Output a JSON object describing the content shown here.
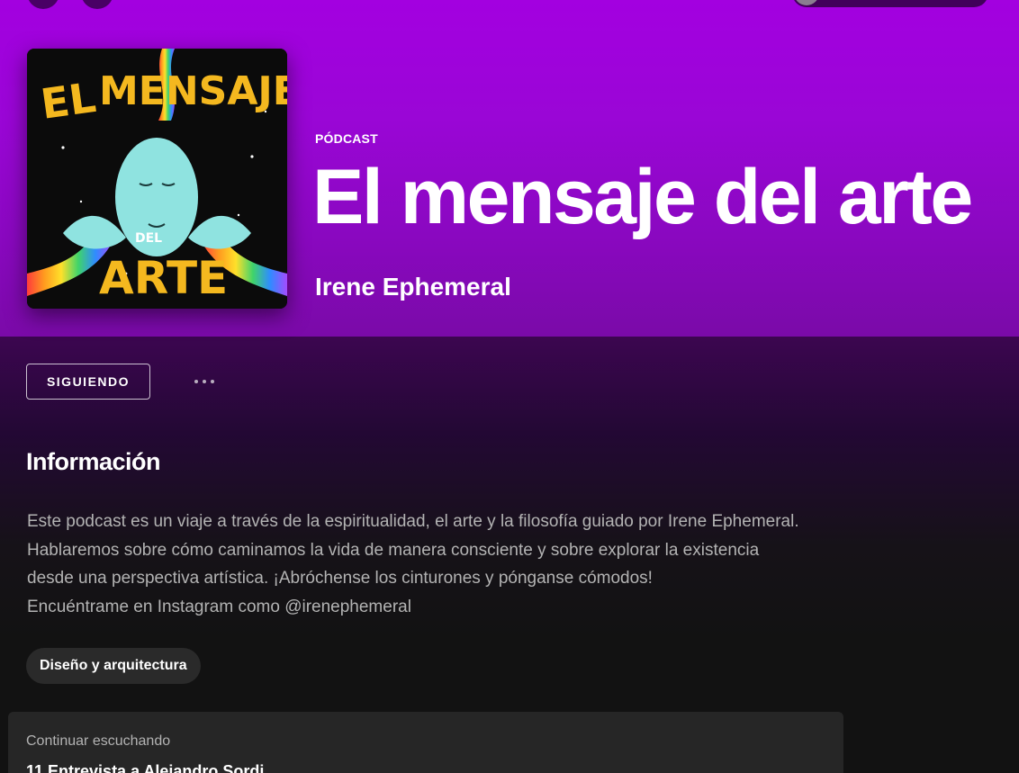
{
  "header": {
    "type_label": "PÓDCAST",
    "title": "El mensaje del arte",
    "author": "Irene Ephemeral"
  },
  "cover": {
    "icon": "podcast-cover-art",
    "colors": {
      "background": "#0b0b0b",
      "lettering": "#f4b81f",
      "face": "#8fe3e0"
    }
  },
  "actions": {
    "follow_label": "SIGUIENDO",
    "more_icon": "more-options-icon"
  },
  "about": {
    "heading": "Información",
    "description_lines": [
      "Este podcast es un viaje a través de la espiritualidad, el arte y la filosofía guiado por Irene Ephemeral.",
      "Hablaremos sobre cómo caminamos la vida de manera consciente y sobre explorar la existencia",
      "desde una perspectiva artística. ¡Abróchense los cinturones y pónganse cómodos!",
      "Encuéntrame en Instagram como @irenephemeral"
    ],
    "category_tag": "Diseño y arquitectura"
  },
  "continue_listening": {
    "label": "Continuar escuchando",
    "episode_title": "11 Entrevista a Alejandro Sordi"
  },
  "theme": {
    "accent": "#a300e0",
    "background": "#121212"
  }
}
